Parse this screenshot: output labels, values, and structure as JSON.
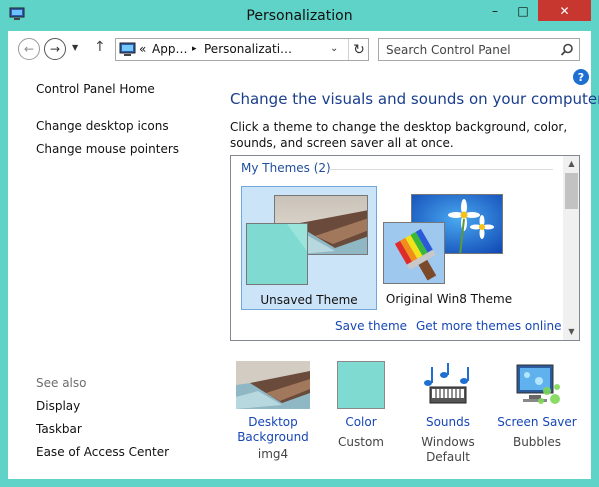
{
  "window": {
    "title": "Personalization",
    "min_label": "–",
    "max_label": "□",
    "close_label": "✕"
  },
  "nav": {
    "back_icon": "←",
    "forward_icon": "→",
    "history_icon": "▼",
    "up_icon": "↑",
    "address": {
      "prefix": "«",
      "seg1": "App…",
      "sep": "▸",
      "seg2": "Personalizati…",
      "dropdown_icon": "⌄",
      "refresh_icon": "↻"
    },
    "search_placeholder": "Search Control Panel"
  },
  "help_label": "?",
  "sidebar": {
    "home": "Control Panel Home",
    "links": [
      "Change desktop icons",
      "Change mouse pointers"
    ],
    "see_also_label": "See also",
    "see_also": [
      "Display",
      "Taskbar",
      "Ease of Access Center"
    ]
  },
  "main": {
    "heading": "Change the visuals and sounds on your computer",
    "description": "Click a theme to change the desktop background, color, sounds, and screen saver all at once.",
    "group_title": "My Themes (2)",
    "themes": [
      {
        "name": "Unsaved Theme",
        "selected": true
      },
      {
        "name": "Original Win8 Theme",
        "selected": false
      }
    ],
    "save_theme": "Save theme",
    "get_more": "Get more themes online"
  },
  "bottom": [
    {
      "label": "Desktop Background",
      "sub": "img4"
    },
    {
      "label": "Color",
      "sub": "Custom"
    },
    {
      "label": "Sounds",
      "sub": "Windows Default"
    },
    {
      "label": "Screen Saver",
      "sub": "Bubbles"
    }
  ],
  "colors": {
    "frame": "#5fd3c7",
    "close": "#c7372f",
    "link": "#1646b6",
    "heading": "#1a3e8c",
    "swatch": "#7fdad1"
  }
}
